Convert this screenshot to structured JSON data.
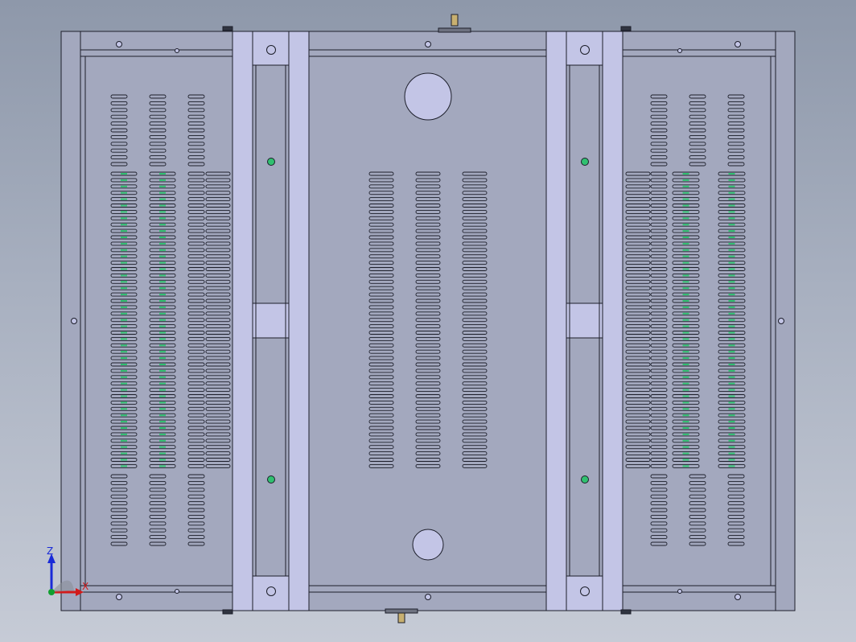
{
  "view": {
    "background_top": "#8e98aa",
    "background_bottom": "#c6cbd6",
    "part_fill": "#a3a8be",
    "part_fill_light": "#c3c5e6",
    "edge_color": "#1c1e2a",
    "hole_highlight": "#30c070"
  },
  "triad": {
    "z_label": "Z",
    "x_label": "X",
    "z_color": "#1a2bd8",
    "x_color": "#d21a1a",
    "y_color": "#10a030"
  }
}
